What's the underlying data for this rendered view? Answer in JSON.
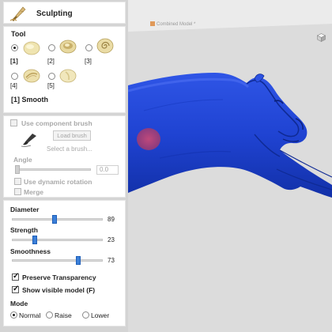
{
  "panel": {
    "title": "Sculpting",
    "title_icon": "sculpt-brush-icon",
    "tool_section": {
      "title": "Tool",
      "tools": [
        {
          "label": "[1]",
          "selected": true,
          "icon": "smooth-tool-icon"
        },
        {
          "label": "[2]",
          "selected": false,
          "icon": "deform-tool-icon"
        },
        {
          "label": "[3]",
          "selected": false,
          "icon": "spiral-tool-icon"
        },
        {
          "label": "[4]",
          "selected": false,
          "icon": "smudge-tool-icon"
        },
        {
          "label": "[5]",
          "selected": false,
          "icon": "erase-tool-icon"
        }
      ],
      "current_tool": "[1] Smooth"
    },
    "component_brush": {
      "use_label": "Use component brush",
      "load_label": "Load brush",
      "select_placeholder": "Select a brush...",
      "angle_label": "Angle",
      "angle_value": "0.0",
      "dynamic_rotation_label": "Use dynamic rotation",
      "merge_label": "Merge",
      "brush_icon": "paint-brush-icon"
    },
    "settings": {
      "diameter_label": "Diameter",
      "diameter_value": "89",
      "diameter_fraction": 0.47,
      "strength_label": "Strength",
      "strength_value": "23",
      "strength_fraction": 0.25,
      "smoothness_label": "Smoothness",
      "smoothness_value": "73",
      "smoothness_fraction": 0.73,
      "preserve_transparency_label": "Preserve Transparency",
      "preserve_transparency_checked": true,
      "show_visible_label": "Show visible model (F)",
      "show_visible_checked": true,
      "mode_label": "Mode",
      "modes": [
        {
          "label": "Normal",
          "selected": true
        },
        {
          "label": "Raise",
          "selected": false
        },
        {
          "label": "Lower",
          "selected": false
        }
      ]
    }
  },
  "viewport": {
    "tab_label": "Combined Model *",
    "view_cube_icon": "view-cube-icon",
    "model_color": "#1c3fd0",
    "brush_cursor_color": "#c2456b"
  }
}
